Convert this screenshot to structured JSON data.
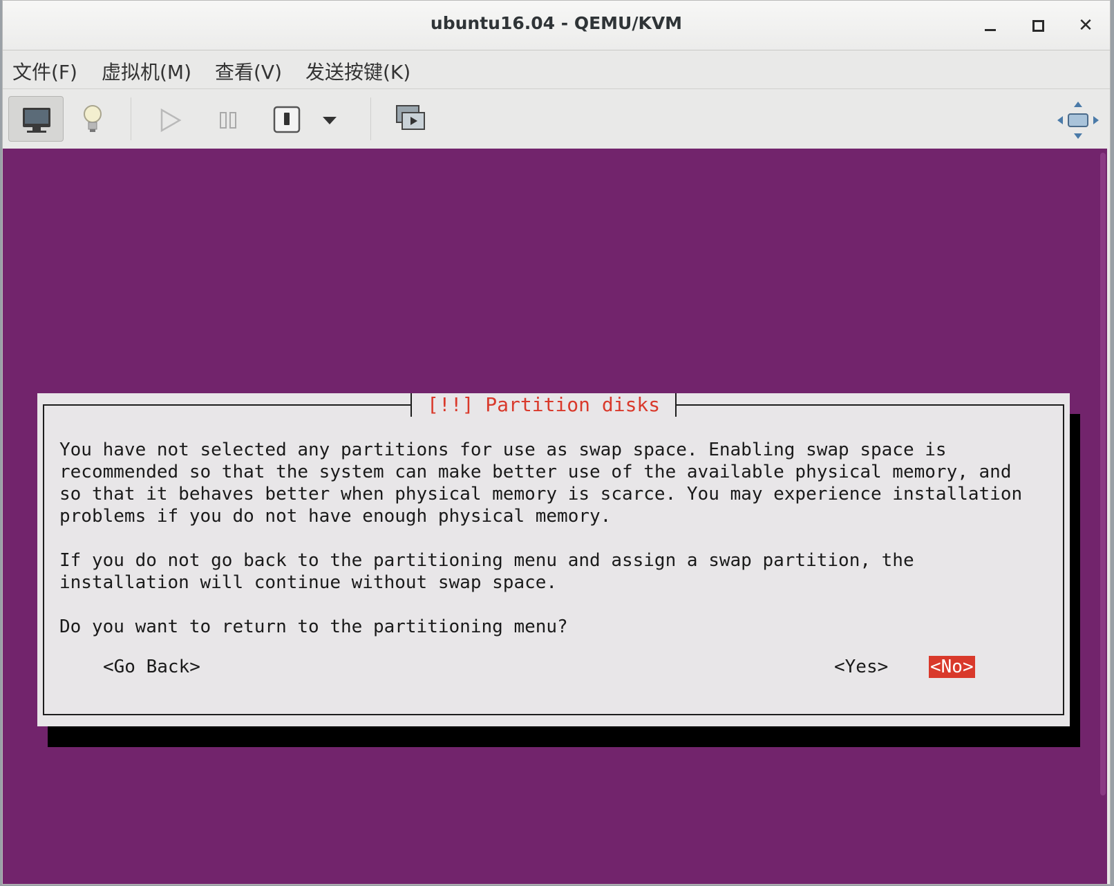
{
  "window": {
    "title": "ubuntu16.04 - QEMU/KVM",
    "minimize_icon": "minimize-icon",
    "maximize_icon": "maximize-icon",
    "close_icon": "close-icon"
  },
  "menubar": {
    "items": [
      {
        "label": "文件(F)"
      },
      {
        "label": "虚拟机(M)"
      },
      {
        "label": "查看(V)"
      },
      {
        "label": "发送按键(K)"
      }
    ]
  },
  "toolbar": {
    "buttons": [
      {
        "icon": "monitor-icon",
        "active": true
      },
      {
        "icon": "lightbulb-icon"
      },
      {
        "icon": "play-icon"
      },
      {
        "icon": "pause-icon"
      },
      {
        "icon": "power-icon"
      },
      {
        "icon": "chevron-down-icon"
      },
      {
        "icon": "snapshot-icon"
      },
      {
        "icon": "fullscreen-icon"
      }
    ]
  },
  "dialog": {
    "title": "[!!] Partition disks",
    "paragraphs": [
      "You have not selected any partitions for use as swap space. Enabling swap space is\nrecommended so that the system can make better use of the available physical memory, and\nso that it behaves better when physical memory is scarce. You may experience installation\nproblems if you do not have enough physical memory.",
      "If you do not go back to the partitioning menu and assign a swap partition, the\ninstallation will continue without swap space.",
      "Do you want to return to the partitioning menu?"
    ],
    "go_back_label": "<Go Back>",
    "yes_label": "<Yes>",
    "no_label": "<No>",
    "title_color": "#d9392b",
    "background_color": "#72246c"
  }
}
